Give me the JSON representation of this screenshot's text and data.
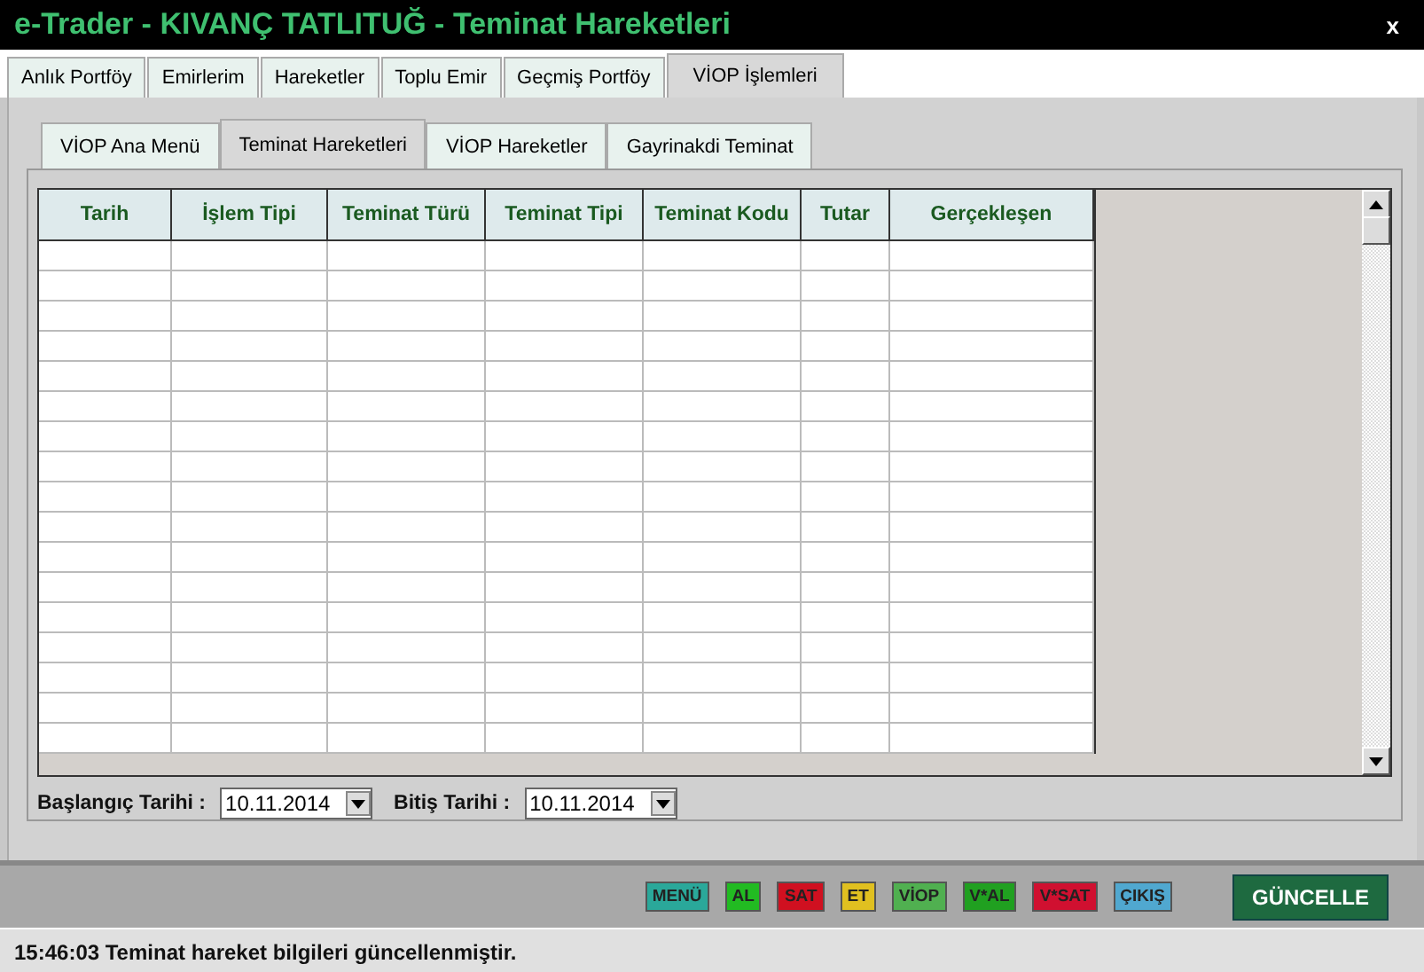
{
  "window": {
    "title": "e-Trader - KIVANÇ TATLITUĞ - Teminat Hareketleri",
    "close": "x"
  },
  "tabs": [
    {
      "label": "Anlık Portföy",
      "selected": false
    },
    {
      "label": "Emirlerim",
      "selected": false
    },
    {
      "label": "Hareketler",
      "selected": false
    },
    {
      "label": "Toplu Emir",
      "selected": false
    },
    {
      "label": "Geçmiş Portföy",
      "selected": false
    },
    {
      "label": "VİOP İşlemleri",
      "selected": true
    }
  ],
  "subtabs": [
    {
      "label": "VİOP Ana Menü",
      "selected": false
    },
    {
      "label": "Teminat Hareketleri",
      "selected": true
    },
    {
      "label": "VİOP Hareketler",
      "selected": false
    },
    {
      "label": "Gayrinakdi Teminat",
      "selected": false
    }
  ],
  "table": {
    "columns": [
      "Tarih",
      "İşlem Tipi",
      "Teminat Türü",
      "Teminat Tipi",
      "Teminat Kodu",
      "Tutar",
      "Gerçekleşen"
    ]
  },
  "filters": [
    {
      "label": "Başlangıç Tarihi :",
      "value": "10.11.2014"
    },
    {
      "label": "Bitiş Tarihi :",
      "value": "10.11.2014"
    }
  ],
  "quick_buttons": [
    {
      "label": "MENÜ",
      "color": "#2aa89a"
    },
    {
      "label": "AL",
      "color": "#22bb22"
    },
    {
      "label": "SAT",
      "color": "#d01020"
    },
    {
      "label": "ET",
      "color": "#e0c020"
    },
    {
      "label": "VİOP",
      "color": "#50b050"
    },
    {
      "label": "V*AL",
      "color": "#20a020"
    },
    {
      "label": "V*SAT",
      "color": "#d01030"
    },
    {
      "label": "ÇIKIŞ",
      "color": "#50a8d0"
    }
  ],
  "update_button": "GÜNCELLE",
  "status_bar": "15:46:03 Teminat hareket bilgileri güncellenmiştir."
}
